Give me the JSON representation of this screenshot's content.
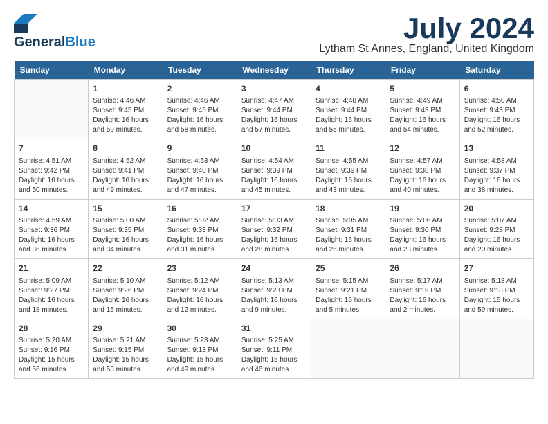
{
  "header": {
    "logo_general": "General",
    "logo_blue": "Blue",
    "month": "July 2024",
    "location": "Lytham St Annes, England, United Kingdom"
  },
  "days_of_week": [
    "Sunday",
    "Monday",
    "Tuesday",
    "Wednesday",
    "Thursday",
    "Friday",
    "Saturday"
  ],
  "weeks": [
    [
      {
        "day": "",
        "info": ""
      },
      {
        "day": "1",
        "info": "Sunrise: 4:46 AM\nSunset: 9:45 PM\nDaylight: 16 hours\nand 59 minutes."
      },
      {
        "day": "2",
        "info": "Sunrise: 4:46 AM\nSunset: 9:45 PM\nDaylight: 16 hours\nand 58 minutes."
      },
      {
        "day": "3",
        "info": "Sunrise: 4:47 AM\nSunset: 9:44 PM\nDaylight: 16 hours\nand 57 minutes."
      },
      {
        "day": "4",
        "info": "Sunrise: 4:48 AM\nSunset: 9:44 PM\nDaylight: 16 hours\nand 55 minutes."
      },
      {
        "day": "5",
        "info": "Sunrise: 4:49 AM\nSunset: 9:43 PM\nDaylight: 16 hours\nand 54 minutes."
      },
      {
        "day": "6",
        "info": "Sunrise: 4:50 AM\nSunset: 9:43 PM\nDaylight: 16 hours\nand 52 minutes."
      }
    ],
    [
      {
        "day": "7",
        "info": "Sunrise: 4:51 AM\nSunset: 9:42 PM\nDaylight: 16 hours\nand 50 minutes."
      },
      {
        "day": "8",
        "info": "Sunrise: 4:52 AM\nSunset: 9:41 PM\nDaylight: 16 hours\nand 49 minutes."
      },
      {
        "day": "9",
        "info": "Sunrise: 4:53 AM\nSunset: 9:40 PM\nDaylight: 16 hours\nand 47 minutes."
      },
      {
        "day": "10",
        "info": "Sunrise: 4:54 AM\nSunset: 9:39 PM\nDaylight: 16 hours\nand 45 minutes."
      },
      {
        "day": "11",
        "info": "Sunrise: 4:55 AM\nSunset: 9:39 PM\nDaylight: 16 hours\nand 43 minutes."
      },
      {
        "day": "12",
        "info": "Sunrise: 4:57 AM\nSunset: 9:38 PM\nDaylight: 16 hours\nand 40 minutes."
      },
      {
        "day": "13",
        "info": "Sunrise: 4:58 AM\nSunset: 9:37 PM\nDaylight: 16 hours\nand 38 minutes."
      }
    ],
    [
      {
        "day": "14",
        "info": "Sunrise: 4:59 AM\nSunset: 9:36 PM\nDaylight: 16 hours\nand 36 minutes."
      },
      {
        "day": "15",
        "info": "Sunrise: 5:00 AM\nSunset: 9:35 PM\nDaylight: 16 hours\nand 34 minutes."
      },
      {
        "day": "16",
        "info": "Sunrise: 5:02 AM\nSunset: 9:33 PM\nDaylight: 16 hours\nand 31 minutes."
      },
      {
        "day": "17",
        "info": "Sunrise: 5:03 AM\nSunset: 9:32 PM\nDaylight: 16 hours\nand 28 minutes."
      },
      {
        "day": "18",
        "info": "Sunrise: 5:05 AM\nSunset: 9:31 PM\nDaylight: 16 hours\nand 26 minutes."
      },
      {
        "day": "19",
        "info": "Sunrise: 5:06 AM\nSunset: 9:30 PM\nDaylight: 16 hours\nand 23 minutes."
      },
      {
        "day": "20",
        "info": "Sunrise: 5:07 AM\nSunset: 9:28 PM\nDaylight: 16 hours\nand 20 minutes."
      }
    ],
    [
      {
        "day": "21",
        "info": "Sunrise: 5:09 AM\nSunset: 9:27 PM\nDaylight: 16 hours\nand 18 minutes."
      },
      {
        "day": "22",
        "info": "Sunrise: 5:10 AM\nSunset: 9:26 PM\nDaylight: 16 hours\nand 15 minutes."
      },
      {
        "day": "23",
        "info": "Sunrise: 5:12 AM\nSunset: 9:24 PM\nDaylight: 16 hours\nand 12 minutes."
      },
      {
        "day": "24",
        "info": "Sunrise: 5:13 AM\nSunset: 9:23 PM\nDaylight: 16 hours\nand 9 minutes."
      },
      {
        "day": "25",
        "info": "Sunrise: 5:15 AM\nSunset: 9:21 PM\nDaylight: 16 hours\nand 5 minutes."
      },
      {
        "day": "26",
        "info": "Sunrise: 5:17 AM\nSunset: 9:19 PM\nDaylight: 16 hours\nand 2 minutes."
      },
      {
        "day": "27",
        "info": "Sunrise: 5:18 AM\nSunset: 9:18 PM\nDaylight: 15 hours\nand 59 minutes."
      }
    ],
    [
      {
        "day": "28",
        "info": "Sunrise: 5:20 AM\nSunset: 9:16 PM\nDaylight: 15 hours\nand 56 minutes."
      },
      {
        "day": "29",
        "info": "Sunrise: 5:21 AM\nSunset: 9:15 PM\nDaylight: 15 hours\nand 53 minutes."
      },
      {
        "day": "30",
        "info": "Sunrise: 5:23 AM\nSunset: 9:13 PM\nDaylight: 15 hours\nand 49 minutes."
      },
      {
        "day": "31",
        "info": "Sunrise: 5:25 AM\nSunset: 9:11 PM\nDaylight: 15 hours\nand 46 minutes."
      },
      {
        "day": "",
        "info": ""
      },
      {
        "day": "",
        "info": ""
      },
      {
        "day": "",
        "info": ""
      }
    ]
  ]
}
